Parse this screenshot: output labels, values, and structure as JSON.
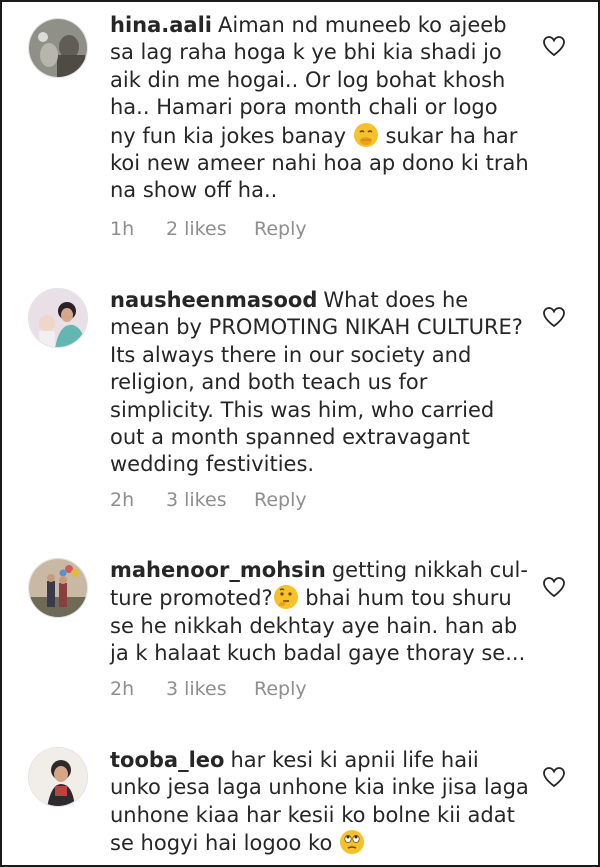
{
  "comments": [
    {
      "username": "hina.aali",
      "text_before": "Aiman nd muneeb ko ajeeb sa lag raha hoga k ye bhi kia shadi jo aik din me hogai.. Or log bohat khosh ha.. Hamari pora month chali or logo ny fun kia jokes banay",
      "emoji": "hand-over-mouth-emoji",
      "text_after": "sukar ha har koi new ameer nahi hoa ap dono ki trah na show off ha..",
      "time": "1h",
      "likes": "2 likes",
      "reply": "Reply"
    },
    {
      "username": "nausheenmasood",
      "text_before": "What does he mean by PROMOTING NIKAH CULTURE? Its always there in our society and religion, and both teach us for simplicity.  This was him, who carried out a month spanned extravagant wedding festivities.",
      "emoji": "",
      "text_after": "",
      "time": "2h",
      "likes": "3 likes",
      "reply": "Reply"
    },
    {
      "username": "mahenoor_mohsin",
      "text_before": "getting nikkah cul-ture promoted?",
      "emoji": "thinking-face-emoji",
      "text_after": "bhai hum tou shuru se he nikkah dekhtay aye hain. han ab ja k halaat kuch badal gaye thoray se...",
      "time": "2h",
      "likes": "3 likes",
      "reply": "Reply"
    },
    {
      "username": "tooba_leo",
      "text_before": "har kesi ki apnii life haii unko jesa laga unhone kia inke jisa laga unhone kiaa har kesii ko bolne kii adat se hogyi hai logoo ko",
      "emoji": "eye-roll-emoji",
      "text_after": "",
      "time": "",
      "likes": "",
      "reply": ""
    }
  ],
  "colors": {
    "text": "#262626",
    "meta": "#8e8e8e",
    "emoji_yellow": "#f7c12b",
    "border": "#1a1a1a"
  }
}
